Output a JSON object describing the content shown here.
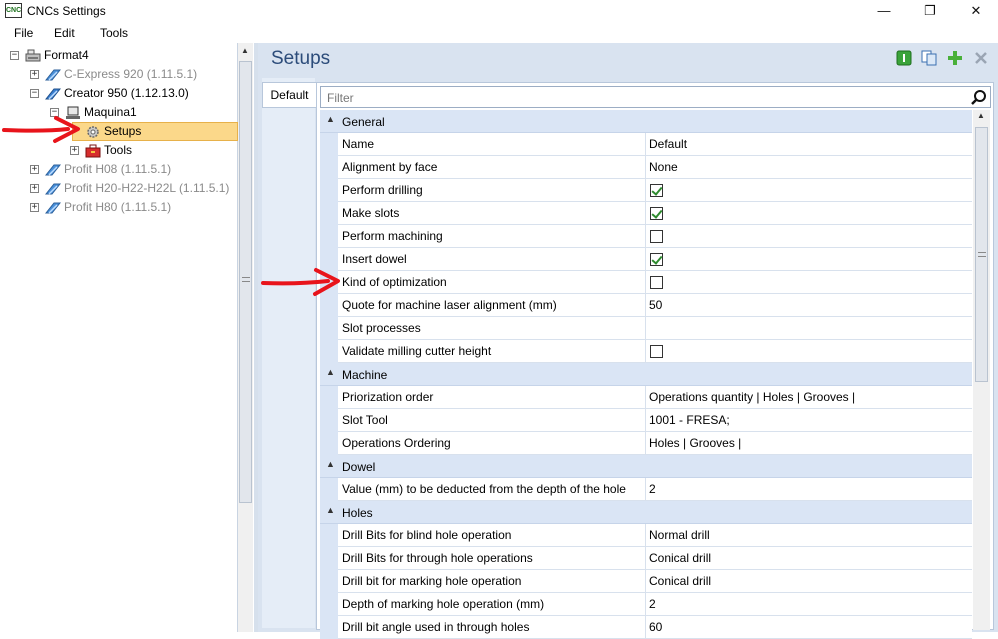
{
  "window": {
    "title": "CNCs Settings",
    "app_icon_text": "CNC",
    "minimize_glyph": "—",
    "restore_glyph": "❐",
    "close_glyph": "✕"
  },
  "menu": [
    "File",
    "Edit",
    "Tools"
  ],
  "tree": [
    {
      "label": "Format4",
      "expander": "−",
      "icon": "computer-icon",
      "muted": false
    },
    {
      "label": "C-Express 920 (1.11.5.1)",
      "expander": "+",
      "icon": "machine-icon",
      "muted": true
    },
    {
      "label": "Creator 950 (1.12.13.0)",
      "expander": "−",
      "icon": "machine-icon",
      "muted": false
    },
    {
      "label": "Maquina1",
      "expander": "−",
      "icon": "monitor-icon",
      "muted": false
    },
    {
      "label": "Setups",
      "expander": "",
      "icon": "gear-icon",
      "muted": false,
      "selected": true
    },
    {
      "label": "Tools",
      "expander": "+",
      "icon": "toolbox-icon",
      "muted": false
    },
    {
      "label": "Profit H08 (1.11.5.1)",
      "expander": "+",
      "icon": "machine-icon",
      "muted": true
    },
    {
      "label": "Profit H20-H22-H22L (1.11.5.1)",
      "expander": "+",
      "icon": "machine-icon",
      "muted": true
    },
    {
      "label": "Profit H80 (1.11.5.1)",
      "expander": "+",
      "icon": "machine-icon",
      "muted": true
    }
  ],
  "pane": {
    "title": "Setups",
    "tab": "Default",
    "filter_placeholder": "Filter"
  },
  "toolbar_icons": [
    "info-icon",
    "copy-icon",
    "add-icon",
    "delete-icon"
  ],
  "grid": [
    {
      "type": "category",
      "label": "General"
    },
    {
      "type": "prop",
      "name": "Name",
      "value": "Default"
    },
    {
      "type": "prop",
      "name": "Alignment by face",
      "value": "None"
    },
    {
      "type": "prop",
      "name": "Perform drilling",
      "checkbox": true
    },
    {
      "type": "prop",
      "name": "Make slots",
      "checkbox": true
    },
    {
      "type": "prop",
      "name": "Perform machining",
      "checkbox": false
    },
    {
      "type": "prop",
      "name": "Insert dowel",
      "checkbox": true
    },
    {
      "type": "prop",
      "name": "Kind of optimization",
      "checkbox": false
    },
    {
      "type": "prop",
      "name": "Quote for machine laser alignment (mm)",
      "value": "50"
    },
    {
      "type": "prop",
      "name": "Slot processes",
      "value": ""
    },
    {
      "type": "prop",
      "name": "Validate milling cutter height",
      "checkbox": false
    },
    {
      "type": "category",
      "label": "Machine"
    },
    {
      "type": "prop",
      "name": "Priorization order",
      "value": "Operations quantity | Holes | Grooves |"
    },
    {
      "type": "prop",
      "name": "Slot Tool",
      "value": "1001 - FRESA;"
    },
    {
      "type": "prop",
      "name": "Operations Ordering",
      "value": "Holes | Grooves |"
    },
    {
      "type": "category",
      "label": "Dowel"
    },
    {
      "type": "prop",
      "name": "Value (mm) to be deducted from the depth of the hole",
      "value": "2"
    },
    {
      "type": "category",
      "label": "Holes"
    },
    {
      "type": "prop",
      "name": "Drill Bits for blind hole operation",
      "value": "Normal drill"
    },
    {
      "type": "prop",
      "name": "Drill Bits for through hole operations",
      "value": "Conical drill"
    },
    {
      "type": "prop",
      "name": "Drill bit for marking hole operation",
      "value": "Conical drill"
    },
    {
      "type": "prop",
      "name": "Depth of marking hole operation (mm)",
      "value": "2"
    },
    {
      "type": "prop",
      "name": "Drill bit angle used in through holes",
      "value": "60"
    }
  ],
  "colors": {
    "accent_blue": "#2c4c7a",
    "selection": "#fbd88a",
    "annotation_red": "#e8141b",
    "check_green": "#2e8b2e"
  }
}
